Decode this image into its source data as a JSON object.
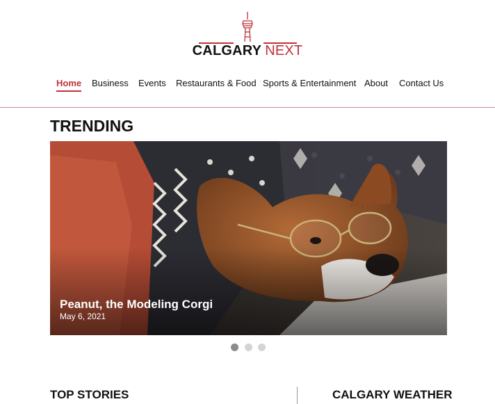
{
  "brand": {
    "word1": "CALGARY",
    "word2": "NEXT",
    "accent_color": "#c0303b",
    "icon": "calgary-tower-icon"
  },
  "nav": {
    "items": [
      {
        "label": "Home",
        "active": true
      },
      {
        "label": "Business",
        "active": false
      },
      {
        "label": "Events",
        "active": false
      },
      {
        "label": "Restaurants & Food",
        "active": false
      },
      {
        "label": "Sports & Entertainment",
        "active": false
      },
      {
        "label": "About",
        "active": false
      },
      {
        "label": "Contact Us",
        "active": false
      }
    ]
  },
  "trending": {
    "heading": "TRENDING",
    "slide": {
      "title": "Peanut, the Modeling Corgi",
      "date": "May 6, 2021",
      "image": "corgi-with-glasses-photo"
    },
    "carousel": {
      "count": 3,
      "active_index": 1
    }
  },
  "sections": {
    "top_stories": "TOP STORIES",
    "weather": "CALGARY WEATHER"
  }
}
